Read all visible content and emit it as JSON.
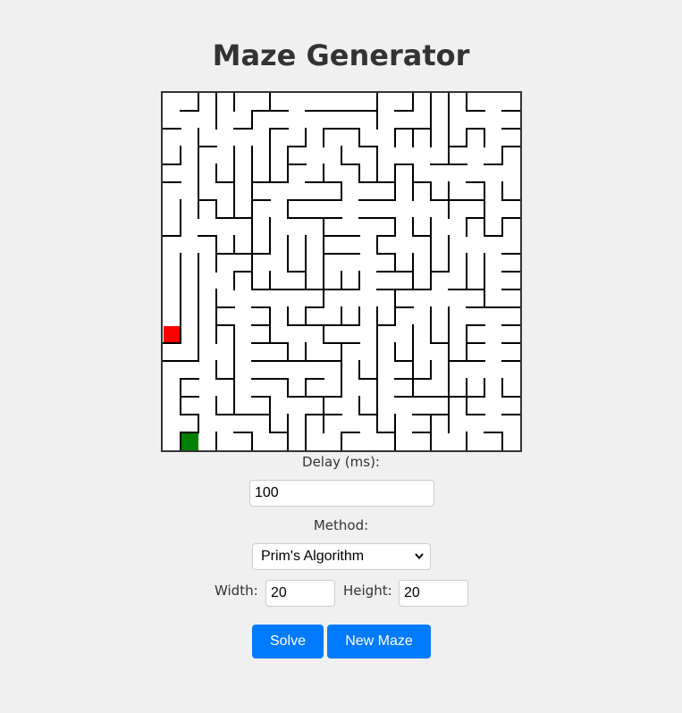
{
  "page_title": "Maze Generator",
  "maze": {
    "cols": 20,
    "rows": 20,
    "wall_color": "#000000",
    "start_color": "#ff0000",
    "end_color": "#008000",
    "start_cell": [
      0,
      13
    ],
    "end_cell": [
      1,
      19
    ]
  },
  "delay": {
    "label": "Delay (ms):",
    "value": "100"
  },
  "method": {
    "label": "Method:",
    "selected": "Prim's Algorithm"
  },
  "width_field": {
    "label": "Width:",
    "value": "20"
  },
  "height_field": {
    "label": "Height:",
    "value": "20"
  },
  "buttons": {
    "solve": "Solve",
    "new_maze": "New Maze"
  },
  "colors": {
    "button": "#007bff",
    "background": "#f0f0f0"
  }
}
